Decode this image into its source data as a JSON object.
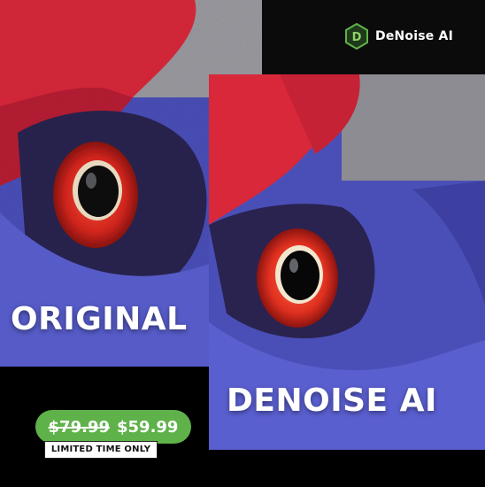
{
  "brand": {
    "name": "DeNoise AI",
    "logo_icon": "denoise-logo-icon",
    "accent": "#5fb24a"
  },
  "labels": {
    "before": "ORIGINAL",
    "after": "DENOISE AI"
  },
  "pricing": {
    "old_price": "$79.99",
    "new_price": "$59.99",
    "limited_text": "LIMITED TIME ONLY",
    "pill_color": "#5fb24a"
  },
  "colors": {
    "background": "#000000",
    "feather_red": "#d8283a",
    "feather_blue": "#4a4fb8",
    "eye_ring": "#e0301f"
  }
}
